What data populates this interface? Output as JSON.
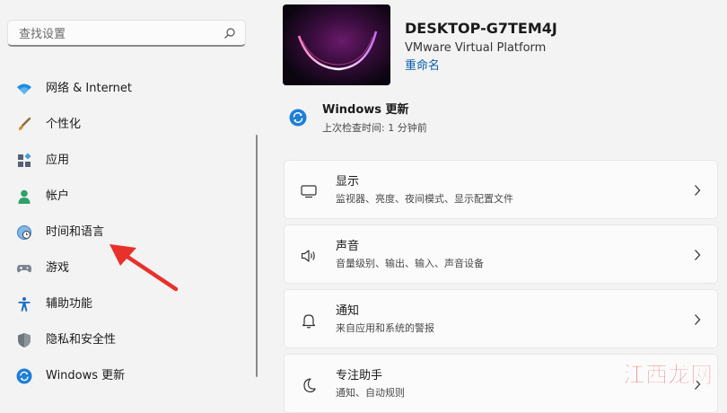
{
  "search": {
    "placeholder": "查找设置"
  },
  "sidebar": {
    "items": [
      {
        "label": "网络 & Internet",
        "icon": "wifi-icon"
      },
      {
        "label": "个性化",
        "icon": "brush-icon"
      },
      {
        "label": "应用",
        "icon": "apps-icon"
      },
      {
        "label": "帐户",
        "icon": "person-icon"
      },
      {
        "label": "时间和语言",
        "icon": "clock-globe-icon"
      },
      {
        "label": "游戏",
        "icon": "gamepad-icon"
      },
      {
        "label": "辅助功能",
        "icon": "accessibility-icon"
      },
      {
        "label": "隐私和安全性",
        "icon": "shield-icon"
      },
      {
        "label": "Windows 更新",
        "icon": "sync-icon"
      }
    ]
  },
  "device": {
    "name": "DESKTOP-G7TEM4J",
    "model": "VMware Virtual Platform",
    "rename": "重命名"
  },
  "update": {
    "title": "Windows 更新",
    "subtitle": "上次检查时间: 1 分钟前"
  },
  "cards": [
    {
      "title": "显示",
      "subtitle": "监视器、亮度、夜间模式、显示配置文件",
      "icon": "monitor-icon"
    },
    {
      "title": "声音",
      "subtitle": "音量级别、输出、输入、声音设备",
      "icon": "speaker-icon"
    },
    {
      "title": "通知",
      "subtitle": "来自应用和系统的警报",
      "icon": "bell-icon"
    },
    {
      "title": "专注助手",
      "subtitle": "通知、自动规则",
      "icon": "moon-icon"
    }
  ],
  "watermark": {
    "text": "江西龙网"
  },
  "colors": {
    "accent": "#0067c0",
    "link": "#0a5fb0",
    "annotation_arrow": "#e8312a",
    "watermark": "#e0322b"
  }
}
